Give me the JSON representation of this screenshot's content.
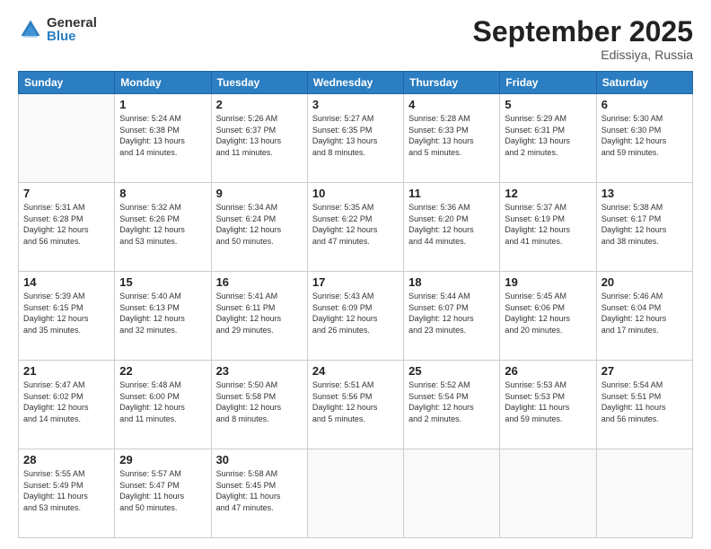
{
  "logo": {
    "general": "General",
    "blue": "Blue"
  },
  "header": {
    "month": "September 2025",
    "location": "Edissiya, Russia"
  },
  "weekdays": [
    "Sunday",
    "Monday",
    "Tuesday",
    "Wednesday",
    "Thursday",
    "Friday",
    "Saturday"
  ],
  "weeks": [
    [
      {
        "day": "",
        "info": ""
      },
      {
        "day": "1",
        "info": "Sunrise: 5:24 AM\nSunset: 6:38 PM\nDaylight: 13 hours\nand 14 minutes."
      },
      {
        "day": "2",
        "info": "Sunrise: 5:26 AM\nSunset: 6:37 PM\nDaylight: 13 hours\nand 11 minutes."
      },
      {
        "day": "3",
        "info": "Sunrise: 5:27 AM\nSunset: 6:35 PM\nDaylight: 13 hours\nand 8 minutes."
      },
      {
        "day": "4",
        "info": "Sunrise: 5:28 AM\nSunset: 6:33 PM\nDaylight: 13 hours\nand 5 minutes."
      },
      {
        "day": "5",
        "info": "Sunrise: 5:29 AM\nSunset: 6:31 PM\nDaylight: 13 hours\nand 2 minutes."
      },
      {
        "day": "6",
        "info": "Sunrise: 5:30 AM\nSunset: 6:30 PM\nDaylight: 12 hours\nand 59 minutes."
      }
    ],
    [
      {
        "day": "7",
        "info": "Sunrise: 5:31 AM\nSunset: 6:28 PM\nDaylight: 12 hours\nand 56 minutes."
      },
      {
        "day": "8",
        "info": "Sunrise: 5:32 AM\nSunset: 6:26 PM\nDaylight: 12 hours\nand 53 minutes."
      },
      {
        "day": "9",
        "info": "Sunrise: 5:34 AM\nSunset: 6:24 PM\nDaylight: 12 hours\nand 50 minutes."
      },
      {
        "day": "10",
        "info": "Sunrise: 5:35 AM\nSunset: 6:22 PM\nDaylight: 12 hours\nand 47 minutes."
      },
      {
        "day": "11",
        "info": "Sunrise: 5:36 AM\nSunset: 6:20 PM\nDaylight: 12 hours\nand 44 minutes."
      },
      {
        "day": "12",
        "info": "Sunrise: 5:37 AM\nSunset: 6:19 PM\nDaylight: 12 hours\nand 41 minutes."
      },
      {
        "day": "13",
        "info": "Sunrise: 5:38 AM\nSunset: 6:17 PM\nDaylight: 12 hours\nand 38 minutes."
      }
    ],
    [
      {
        "day": "14",
        "info": "Sunrise: 5:39 AM\nSunset: 6:15 PM\nDaylight: 12 hours\nand 35 minutes."
      },
      {
        "day": "15",
        "info": "Sunrise: 5:40 AM\nSunset: 6:13 PM\nDaylight: 12 hours\nand 32 minutes."
      },
      {
        "day": "16",
        "info": "Sunrise: 5:41 AM\nSunset: 6:11 PM\nDaylight: 12 hours\nand 29 minutes."
      },
      {
        "day": "17",
        "info": "Sunrise: 5:43 AM\nSunset: 6:09 PM\nDaylight: 12 hours\nand 26 minutes."
      },
      {
        "day": "18",
        "info": "Sunrise: 5:44 AM\nSunset: 6:07 PM\nDaylight: 12 hours\nand 23 minutes."
      },
      {
        "day": "19",
        "info": "Sunrise: 5:45 AM\nSunset: 6:06 PM\nDaylight: 12 hours\nand 20 minutes."
      },
      {
        "day": "20",
        "info": "Sunrise: 5:46 AM\nSunset: 6:04 PM\nDaylight: 12 hours\nand 17 minutes."
      }
    ],
    [
      {
        "day": "21",
        "info": "Sunrise: 5:47 AM\nSunset: 6:02 PM\nDaylight: 12 hours\nand 14 minutes."
      },
      {
        "day": "22",
        "info": "Sunrise: 5:48 AM\nSunset: 6:00 PM\nDaylight: 12 hours\nand 11 minutes."
      },
      {
        "day": "23",
        "info": "Sunrise: 5:50 AM\nSunset: 5:58 PM\nDaylight: 12 hours\nand 8 minutes."
      },
      {
        "day": "24",
        "info": "Sunrise: 5:51 AM\nSunset: 5:56 PM\nDaylight: 12 hours\nand 5 minutes."
      },
      {
        "day": "25",
        "info": "Sunrise: 5:52 AM\nSunset: 5:54 PM\nDaylight: 12 hours\nand 2 minutes."
      },
      {
        "day": "26",
        "info": "Sunrise: 5:53 AM\nSunset: 5:53 PM\nDaylight: 11 hours\nand 59 minutes."
      },
      {
        "day": "27",
        "info": "Sunrise: 5:54 AM\nSunset: 5:51 PM\nDaylight: 11 hours\nand 56 minutes."
      }
    ],
    [
      {
        "day": "28",
        "info": "Sunrise: 5:55 AM\nSunset: 5:49 PM\nDaylight: 11 hours\nand 53 minutes."
      },
      {
        "day": "29",
        "info": "Sunrise: 5:57 AM\nSunset: 5:47 PM\nDaylight: 11 hours\nand 50 minutes."
      },
      {
        "day": "30",
        "info": "Sunrise: 5:58 AM\nSunset: 5:45 PM\nDaylight: 11 hours\nand 47 minutes."
      },
      {
        "day": "",
        "info": ""
      },
      {
        "day": "",
        "info": ""
      },
      {
        "day": "",
        "info": ""
      },
      {
        "day": "",
        "info": ""
      }
    ]
  ]
}
